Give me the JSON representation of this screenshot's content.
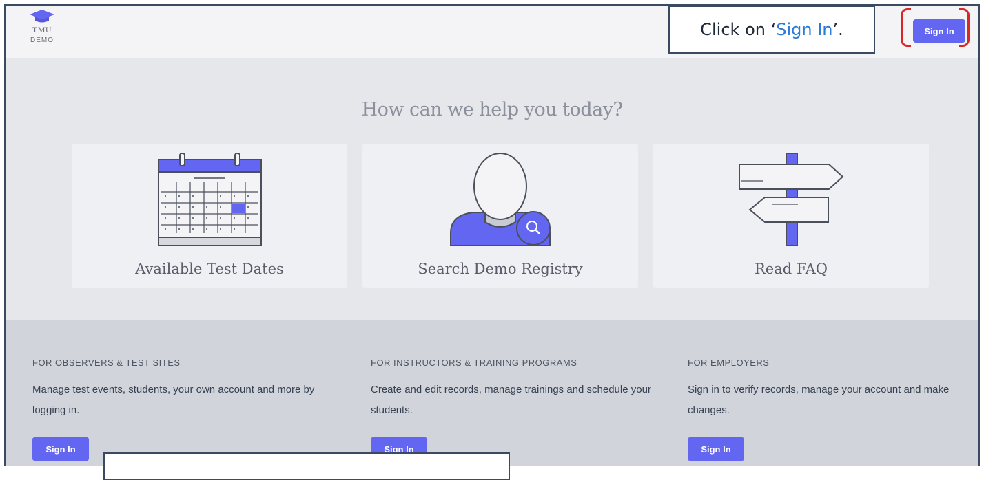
{
  "header": {
    "logo_line1": "TMU",
    "logo_line2": "DEMO",
    "signin_label": "Sign In"
  },
  "callout": {
    "prefix": "Click on ‘",
    "highlight": "Sign In",
    "suffix": "’."
  },
  "hero": {
    "title": "How can we help you today?"
  },
  "cards": [
    {
      "label": "Available Test Dates",
      "icon": "calendar-icon"
    },
    {
      "label": "Search Demo Registry",
      "icon": "person-search-icon"
    },
    {
      "label": "Read FAQ",
      "icon": "signpost-icon"
    }
  ],
  "footer": {
    "columns": [
      {
        "heading": "FOR OBSERVERS & TEST SITES",
        "text": "Manage test events, students, your own account and more by logging in.",
        "button": "Sign In"
      },
      {
        "heading": "FOR INSTRUCTORS & TRAINING PROGRAMS",
        "text": "Create and edit records, manage trainings and schedule your students.",
        "button": "Sign In"
      },
      {
        "heading": "FOR EMPLOYERS",
        "text": "Sign in to verify records, manage your account and make changes.",
        "button": "Sign In"
      }
    ]
  },
  "colors": {
    "accent": "#6366f1",
    "annotation_border": "#3a4a63",
    "highlight_bracket": "#dc2626"
  }
}
